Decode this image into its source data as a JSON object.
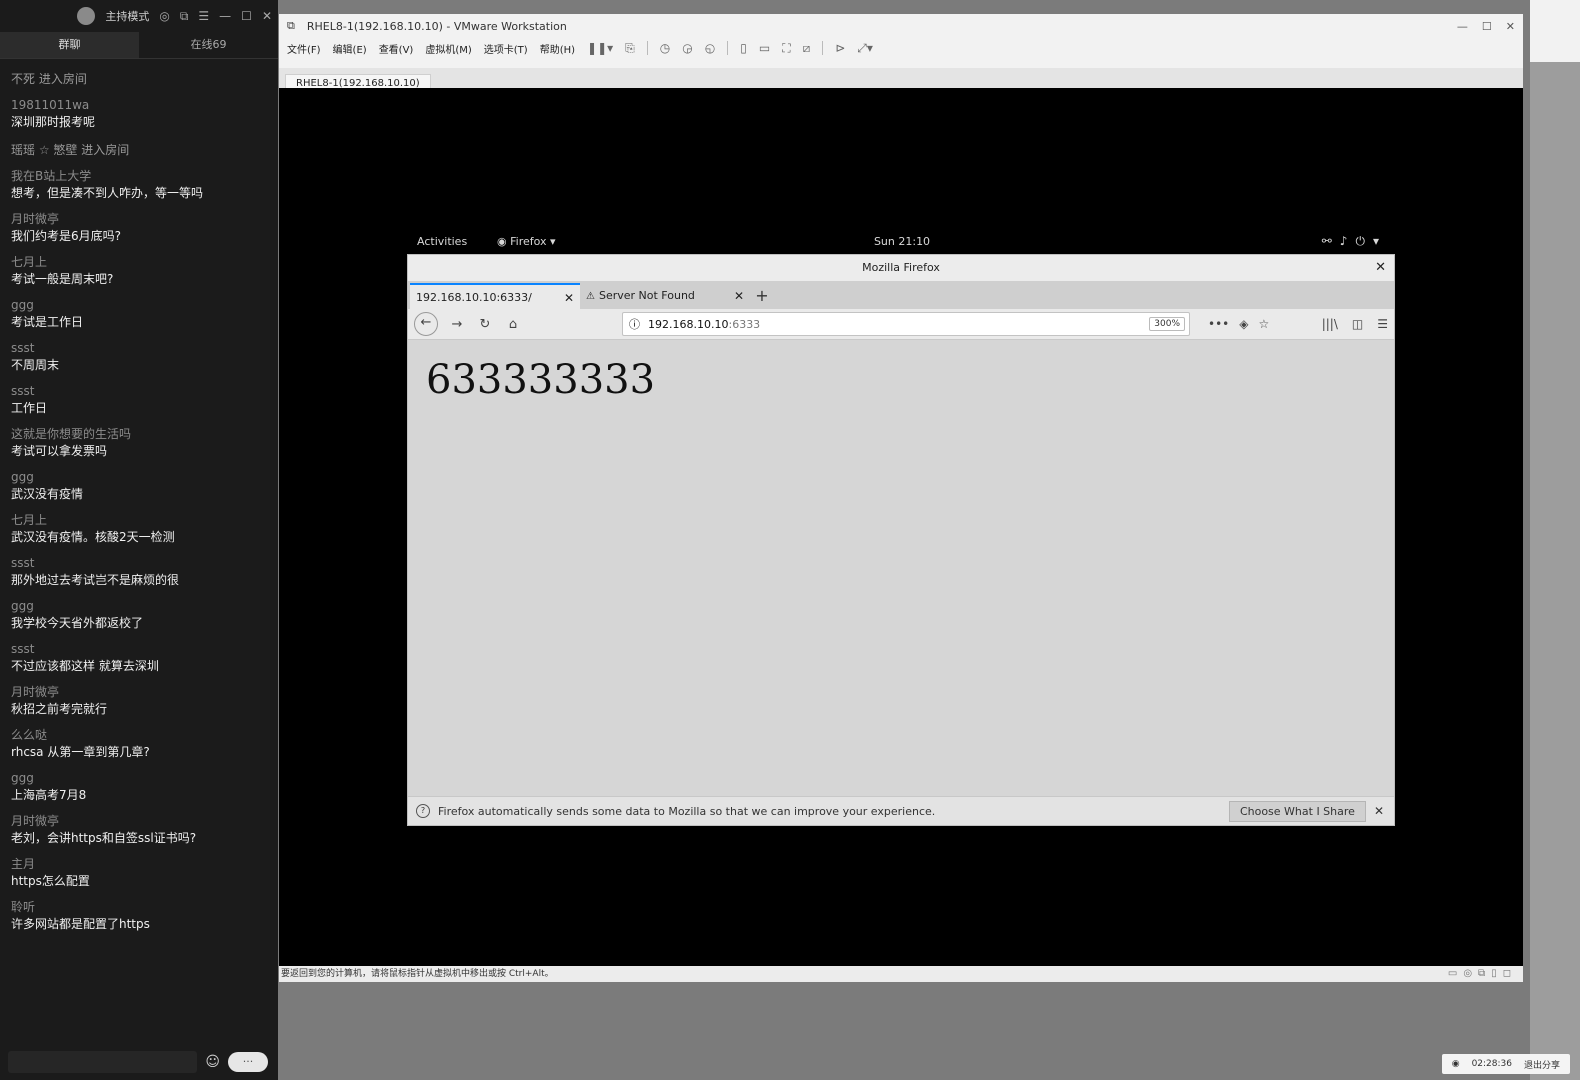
{
  "chat": {
    "host_mode": "主持模式",
    "tabs": [
      "群聊",
      "在线69"
    ],
    "messages": [
      {
        "user": "",
        "text": "不死 进入房间",
        "sys": true
      },
      {
        "user": "19811011wa",
        "text": "深圳那时报考呢"
      },
      {
        "user": "",
        "text": "瑶瑶 ☆ 慜壁 进入房间",
        "sys": true
      },
      {
        "user": "我在B站上大学",
        "text": "想考，但是凑不到人咋办，等一等吗"
      },
      {
        "user": "月时微亭",
        "text": "我们约考是6月底吗?"
      },
      {
        "user": "七月上",
        "text": "考试一般是周末吧?"
      },
      {
        "user": "ggg",
        "text": "考试是工作日"
      },
      {
        "user": "ssst",
        "text": "不周周末"
      },
      {
        "user": "ssst",
        "text": "工作日"
      },
      {
        "user": "这就是你想要的生活吗",
        "text": "考试可以拿发票吗"
      },
      {
        "user": "ggg",
        "text": "武汉没有疫情"
      },
      {
        "user": "七月上",
        "text": "武汉没有疫情。核酸2天一检测"
      },
      {
        "user": "ssst",
        "text": "那外地过去考试岂不是麻烦的很"
      },
      {
        "user": "ggg",
        "text": "我学校今天省外都返校了"
      },
      {
        "user": "ssst",
        "text": "不过应该都这样 就算去深圳"
      },
      {
        "user": "月时微亭",
        "text": "秋招之前考完就行"
      },
      {
        "user": "么么哒",
        "text": "rhcsa 从第一章到第几章?"
      },
      {
        "user": "ggg",
        "text": "上海高考7月8"
      },
      {
        "user": "月时微亭",
        "text": "老刘，会讲https和自签ssl证书吗?"
      },
      {
        "user": "主月",
        "text": "https怎么配置"
      },
      {
        "user": "聆听",
        "text": "许多网站都是配置了https"
      }
    ]
  },
  "vmware": {
    "title": "RHEL8-1(192.168.10.10) - VMware Workstation",
    "menu": [
      "文件(F)",
      "编辑(E)",
      "查看(V)",
      "虚拟机(M)",
      "选项卡(T)",
      "帮助(H)"
    ],
    "vm_tab": "RHEL8-1(192.168.10.10)",
    "status": "要返回到您的计算机，请将鼠标指针从虚拟机中移出或按 Ctrl+Alt。"
  },
  "gnome": {
    "activities": "Activities",
    "app": "Firefox",
    "clock": "Sun 21:10"
  },
  "firefox": {
    "window_title": "Mozilla Firefox",
    "tabs": [
      {
        "label": "192.168.10.10:6333/",
        "active": true
      },
      {
        "label": "Server Not Found",
        "active": false
      }
    ],
    "url_host": "192.168.10.10",
    "url_port": ":6333",
    "zoom": "300%",
    "page_text": "633333333",
    "notification": "Firefox automatically sends some data to Mozilla so that we can improve your experience.",
    "choose_button": "Choose What I Share"
  },
  "taskbar": {
    "time": "02:28:36",
    "exit_share": "退出分享"
  }
}
